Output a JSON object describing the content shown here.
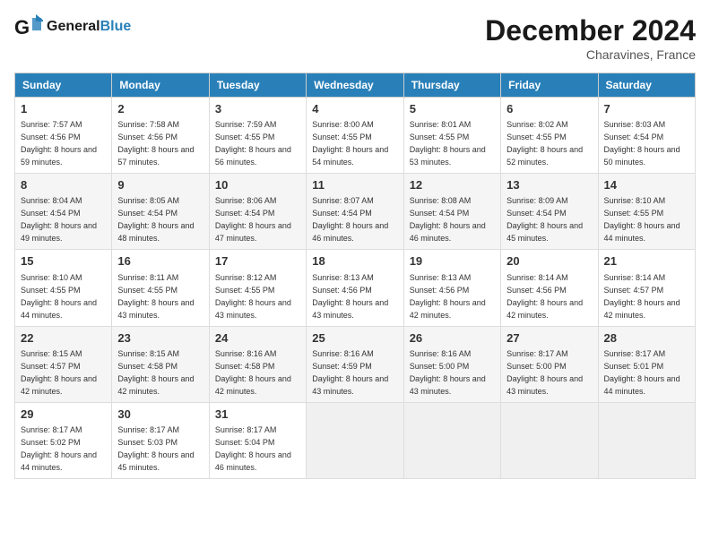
{
  "header": {
    "logo_text_general": "General",
    "logo_text_blue": "Blue",
    "month_year": "December 2024",
    "location": "Charavines, France"
  },
  "weekdays": [
    "Sunday",
    "Monday",
    "Tuesday",
    "Wednesday",
    "Thursday",
    "Friday",
    "Saturday"
  ],
  "weeks": [
    [
      {
        "day": "1",
        "sunrise": "Sunrise: 7:57 AM",
        "sunset": "Sunset: 4:56 PM",
        "daylight": "Daylight: 8 hours and 59 minutes."
      },
      {
        "day": "2",
        "sunrise": "Sunrise: 7:58 AM",
        "sunset": "Sunset: 4:56 PM",
        "daylight": "Daylight: 8 hours and 57 minutes."
      },
      {
        "day": "3",
        "sunrise": "Sunrise: 7:59 AM",
        "sunset": "Sunset: 4:55 PM",
        "daylight": "Daylight: 8 hours and 56 minutes."
      },
      {
        "day": "4",
        "sunrise": "Sunrise: 8:00 AM",
        "sunset": "Sunset: 4:55 PM",
        "daylight": "Daylight: 8 hours and 54 minutes."
      },
      {
        "day": "5",
        "sunrise": "Sunrise: 8:01 AM",
        "sunset": "Sunset: 4:55 PM",
        "daylight": "Daylight: 8 hours and 53 minutes."
      },
      {
        "day": "6",
        "sunrise": "Sunrise: 8:02 AM",
        "sunset": "Sunset: 4:55 PM",
        "daylight": "Daylight: 8 hours and 52 minutes."
      },
      {
        "day": "7",
        "sunrise": "Sunrise: 8:03 AM",
        "sunset": "Sunset: 4:54 PM",
        "daylight": "Daylight: 8 hours and 50 minutes."
      }
    ],
    [
      {
        "day": "8",
        "sunrise": "Sunrise: 8:04 AM",
        "sunset": "Sunset: 4:54 PM",
        "daylight": "Daylight: 8 hours and 49 minutes."
      },
      {
        "day": "9",
        "sunrise": "Sunrise: 8:05 AM",
        "sunset": "Sunset: 4:54 PM",
        "daylight": "Daylight: 8 hours and 48 minutes."
      },
      {
        "day": "10",
        "sunrise": "Sunrise: 8:06 AM",
        "sunset": "Sunset: 4:54 PM",
        "daylight": "Daylight: 8 hours and 47 minutes."
      },
      {
        "day": "11",
        "sunrise": "Sunrise: 8:07 AM",
        "sunset": "Sunset: 4:54 PM",
        "daylight": "Daylight: 8 hours and 46 minutes."
      },
      {
        "day": "12",
        "sunrise": "Sunrise: 8:08 AM",
        "sunset": "Sunset: 4:54 PM",
        "daylight": "Daylight: 8 hours and 46 minutes."
      },
      {
        "day": "13",
        "sunrise": "Sunrise: 8:09 AM",
        "sunset": "Sunset: 4:54 PM",
        "daylight": "Daylight: 8 hours and 45 minutes."
      },
      {
        "day": "14",
        "sunrise": "Sunrise: 8:10 AM",
        "sunset": "Sunset: 4:55 PM",
        "daylight": "Daylight: 8 hours and 44 minutes."
      }
    ],
    [
      {
        "day": "15",
        "sunrise": "Sunrise: 8:10 AM",
        "sunset": "Sunset: 4:55 PM",
        "daylight": "Daylight: 8 hours and 44 minutes."
      },
      {
        "day": "16",
        "sunrise": "Sunrise: 8:11 AM",
        "sunset": "Sunset: 4:55 PM",
        "daylight": "Daylight: 8 hours and 43 minutes."
      },
      {
        "day": "17",
        "sunrise": "Sunrise: 8:12 AM",
        "sunset": "Sunset: 4:55 PM",
        "daylight": "Daylight: 8 hours and 43 minutes."
      },
      {
        "day": "18",
        "sunrise": "Sunrise: 8:13 AM",
        "sunset": "Sunset: 4:56 PM",
        "daylight": "Daylight: 8 hours and 43 minutes."
      },
      {
        "day": "19",
        "sunrise": "Sunrise: 8:13 AM",
        "sunset": "Sunset: 4:56 PM",
        "daylight": "Daylight: 8 hours and 42 minutes."
      },
      {
        "day": "20",
        "sunrise": "Sunrise: 8:14 AM",
        "sunset": "Sunset: 4:56 PM",
        "daylight": "Daylight: 8 hours and 42 minutes."
      },
      {
        "day": "21",
        "sunrise": "Sunrise: 8:14 AM",
        "sunset": "Sunset: 4:57 PM",
        "daylight": "Daylight: 8 hours and 42 minutes."
      }
    ],
    [
      {
        "day": "22",
        "sunrise": "Sunrise: 8:15 AM",
        "sunset": "Sunset: 4:57 PM",
        "daylight": "Daylight: 8 hours and 42 minutes."
      },
      {
        "day": "23",
        "sunrise": "Sunrise: 8:15 AM",
        "sunset": "Sunset: 4:58 PM",
        "daylight": "Daylight: 8 hours and 42 minutes."
      },
      {
        "day": "24",
        "sunrise": "Sunrise: 8:16 AM",
        "sunset": "Sunset: 4:58 PM",
        "daylight": "Daylight: 8 hours and 42 minutes."
      },
      {
        "day": "25",
        "sunrise": "Sunrise: 8:16 AM",
        "sunset": "Sunset: 4:59 PM",
        "daylight": "Daylight: 8 hours and 43 minutes."
      },
      {
        "day": "26",
        "sunrise": "Sunrise: 8:16 AM",
        "sunset": "Sunset: 5:00 PM",
        "daylight": "Daylight: 8 hours and 43 minutes."
      },
      {
        "day": "27",
        "sunrise": "Sunrise: 8:17 AM",
        "sunset": "Sunset: 5:00 PM",
        "daylight": "Daylight: 8 hours and 43 minutes."
      },
      {
        "day": "28",
        "sunrise": "Sunrise: 8:17 AM",
        "sunset": "Sunset: 5:01 PM",
        "daylight": "Daylight: 8 hours and 44 minutes."
      }
    ],
    [
      {
        "day": "29",
        "sunrise": "Sunrise: 8:17 AM",
        "sunset": "Sunset: 5:02 PM",
        "daylight": "Daylight: 8 hours and 44 minutes."
      },
      {
        "day": "30",
        "sunrise": "Sunrise: 8:17 AM",
        "sunset": "Sunset: 5:03 PM",
        "daylight": "Daylight: 8 hours and 45 minutes."
      },
      {
        "day": "31",
        "sunrise": "Sunrise: 8:17 AM",
        "sunset": "Sunset: 5:04 PM",
        "daylight": "Daylight: 8 hours and 46 minutes."
      },
      null,
      null,
      null,
      null
    ]
  ]
}
